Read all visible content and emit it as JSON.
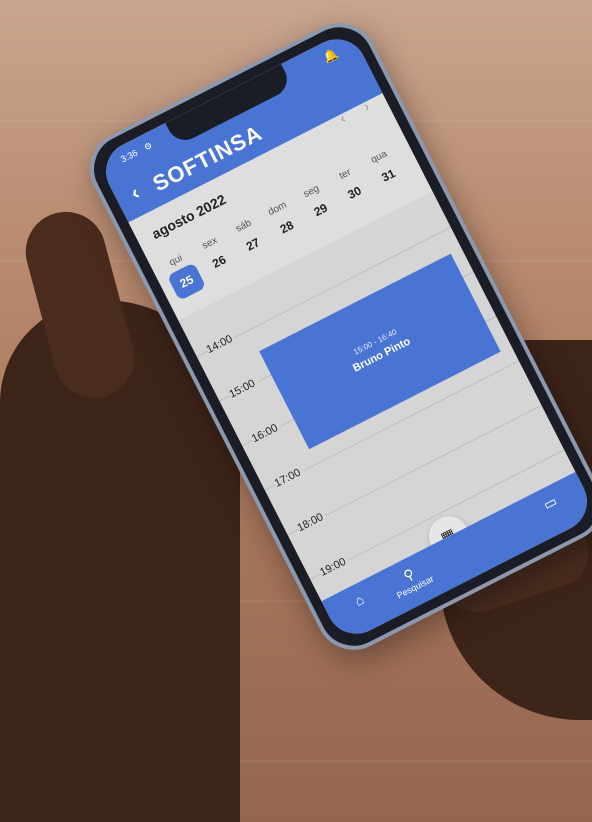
{
  "status": {
    "time": "3:36",
    "settings_icon": "gear-icon",
    "bell_icon": "bell-icon"
  },
  "header": {
    "back_icon": "chevron-left-icon",
    "brand": "SOFTINSA"
  },
  "calendar": {
    "month_label": "agosto 2022",
    "prev_icon": "chevron-left-icon",
    "next_icon": "chevron-right-icon",
    "days": [
      {
        "name": "qui",
        "num": "25",
        "selected": true
      },
      {
        "name": "sex",
        "num": "26"
      },
      {
        "name": "sáb",
        "num": "27"
      },
      {
        "name": "dom",
        "num": "28"
      },
      {
        "name": "seg",
        "num": "29"
      },
      {
        "name": "ter",
        "num": "30"
      },
      {
        "name": "qua",
        "num": "31"
      }
    ]
  },
  "timeline": {
    "hours": [
      "14:00",
      "15:00",
      "16:00",
      "17:00",
      "18:00",
      "19:00"
    ],
    "event": {
      "time": "15:00 - 16:40",
      "name": "Bruno Pinto"
    }
  },
  "bottom_nav": {
    "home_icon": "home-icon",
    "search_label": "Pesquisar",
    "search_icon": "search-icon",
    "qr_icon": "qr-code-icon",
    "calendar_icon": "calendar-icon"
  },
  "colors": {
    "accent": "#4a74d4",
    "screen_bg": "#d5d5d5"
  }
}
